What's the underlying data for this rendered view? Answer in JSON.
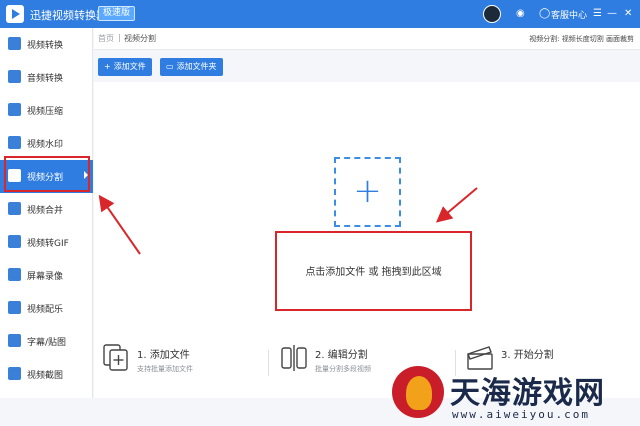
{
  "window": {
    "app_name": "迅捷视频转换器",
    "edition_badge": "极速版",
    "help_icon": "chat-bubble-icon",
    "help_label": "客服中心",
    "menu_glyph": "☰",
    "minimize_glyph": "—",
    "close_glyph": "✕",
    "shield_glyph": "◉",
    "help_glyph": "◯"
  },
  "sidebar": {
    "items": [
      {
        "label": "视频转换",
        "icon": "video-convert-icon"
      },
      {
        "label": "音频转换",
        "icon": "audio-convert-icon"
      },
      {
        "label": "视频压缩",
        "icon": "video-compress-icon"
      },
      {
        "label": "视频水印",
        "icon": "video-watermark-icon"
      },
      {
        "label": "视频分割",
        "icon": "video-split-icon",
        "active": true
      },
      {
        "label": "视频合并",
        "icon": "video-merge-icon"
      },
      {
        "label": "视频转GIF",
        "icon": "video-gif-icon"
      },
      {
        "label": "屏幕录像",
        "icon": "screen-record-icon"
      },
      {
        "label": "视频配乐",
        "icon": "video-music-icon"
      },
      {
        "label": "字幕/贴图",
        "icon": "subtitle-sticker-icon"
      },
      {
        "label": "视频截图",
        "icon": "video-screenshot-icon"
      }
    ]
  },
  "breadcrumb": {
    "home": "首页",
    "separator": "|",
    "current": "视频分割",
    "right_text": "视频分割: 视频长度切割 画面裁剪"
  },
  "toolbar": {
    "add_file": "添加文件",
    "add_folder": "添加文件夹",
    "add_file_glyph": "+",
    "add_folder_glyph": "▭"
  },
  "dropzone": {
    "plus": "+",
    "hint": "点击添加文件 或 拖拽到此区域"
  },
  "steps": [
    {
      "title": "1. 添加文件",
      "desc": "支持批量添加文件",
      "icon": "add-file-icon"
    },
    {
      "title": "2. 编辑分割",
      "desc": "批量分割多段视频",
      "icon": "edit-split-icon"
    },
    {
      "title": "3. 开始分割",
      "desc": "",
      "icon": "start-split-icon"
    }
  ],
  "watermark": {
    "title": "天海游戏网",
    "url": "www.aiweiyou.com",
    "icon": "flame-logo-icon"
  },
  "colors": {
    "accent": "#2f7de1",
    "annotation_red": "#d9262b",
    "dashed_border": "#3b8de6"
  }
}
